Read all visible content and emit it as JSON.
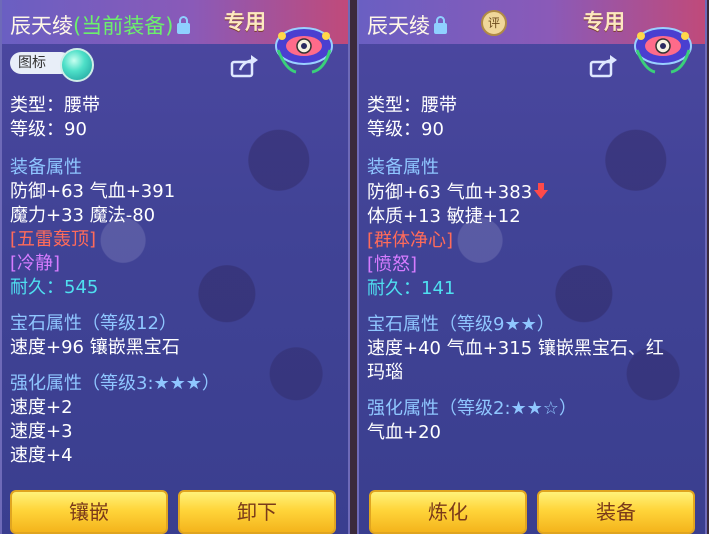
{
  "left": {
    "title": "辰天绫",
    "title_suffix": "(当前装备)",
    "zhuanyong": "专用",
    "tag": "图标",
    "lines": {
      "type": "类型：腰带",
      "level": "等级：90",
      "equip_attr_header": "装备属性",
      "attr1": "防御+63 气血+391",
      "attr2": "魔力+33 魔法-80",
      "special_skill": "[五雷轰顶]",
      "special_effect": "[冷静]",
      "durability": "耐久：545",
      "gem_header": "宝石属性（等级12）",
      "gem_attr": "速度+96 镶嵌黑宝石",
      "enhance_header": "强化属性（等级3:★★★）",
      "enhance1": "速度+2",
      "enhance2": "速度+3",
      "enhance3": "速度+4 "
    },
    "buttons": {
      "inlay": "镶嵌",
      "unequip": "卸下"
    }
  },
  "right": {
    "title": "辰天绫",
    "ping": "评",
    "zhuanyong": "专用",
    "lines": {
      "type": "类型：腰带",
      "level": "等级：90",
      "equip_attr_header": "装备属性",
      "attr1": "防御+63 气血+383",
      "attr2": "体质+13 敏捷+12",
      "special_skill": "[群体净心]",
      "special_effect": "[愤怒]",
      "durability": "耐久：141",
      "gem_header": "宝石属性（等级9★★）",
      "gem_attr1": "速度+40 气血+315 镶嵌黑宝石、红",
      "gem_attr2": "玛瑙",
      "enhance_header": "强化属性（等级2:★★☆）",
      "enhance1": "气血+20"
    },
    "buttons": {
      "refine": "炼化",
      "equip": "装备"
    }
  },
  "colors": {
    "section": "#8fc6ff",
    "skill": "#ff6b5a",
    "effect": "#d67cff",
    "durability": "#4fe0f0",
    "title_highlight": "#6cf06c",
    "button": "#ffd53a"
  },
  "icons": {
    "lock": "lock-icon",
    "share": "share-icon",
    "down_arrow": "down-arrow-icon",
    "item": "sash-item-icon",
    "orb": "orb-icon"
  }
}
